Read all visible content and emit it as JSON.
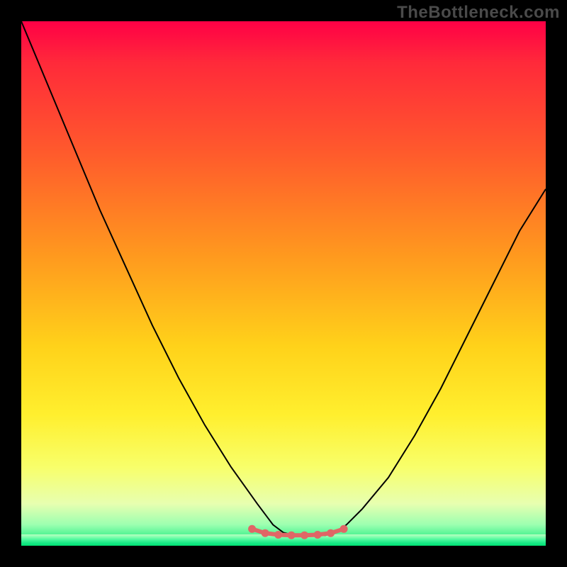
{
  "watermark": "TheBottleneck.com",
  "colors": {
    "frame_bg": "#000000",
    "curve_stroke": "#000000",
    "marker_fill": "#e06666",
    "gradient_top": "#ff0046",
    "gradient_bottom": "#00e374"
  },
  "chart_data": {
    "type": "line",
    "title": "",
    "xlabel": "",
    "ylabel": "",
    "xlim": [
      0,
      100
    ],
    "ylim": [
      0,
      100
    ],
    "grid": false,
    "legend": false,
    "note": "Background is a vertical heat gradient (red top → green bottom). Curve is a V-shaped bottleneck-cost profile with a flat minimum near x≈48–60 at y≈2; left branch steeper than right. Values estimated from pixels.",
    "series": [
      {
        "name": "cost-curve",
        "x": [
          0,
          5,
          10,
          15,
          20,
          25,
          30,
          35,
          40,
          45,
          48,
          50,
          52,
          55,
          58,
          60,
          62,
          65,
          70,
          75,
          80,
          85,
          90,
          95,
          100
        ],
        "y": [
          100,
          88,
          76,
          64,
          53,
          42,
          32,
          23,
          15,
          8,
          4,
          2.5,
          2,
          2,
          2,
          2.5,
          4,
          7,
          13,
          21,
          30,
          40,
          50,
          60,
          68
        ]
      }
    ],
    "markers": {
      "name": "flat-minimum-dots",
      "x": [
        44,
        46.5,
        49,
        51.5,
        54,
        56.5,
        59,
        61.5
      ],
      "y": [
        3.2,
        2.4,
        2.1,
        2.0,
        2.0,
        2.1,
        2.4,
        3.2
      ]
    }
  }
}
